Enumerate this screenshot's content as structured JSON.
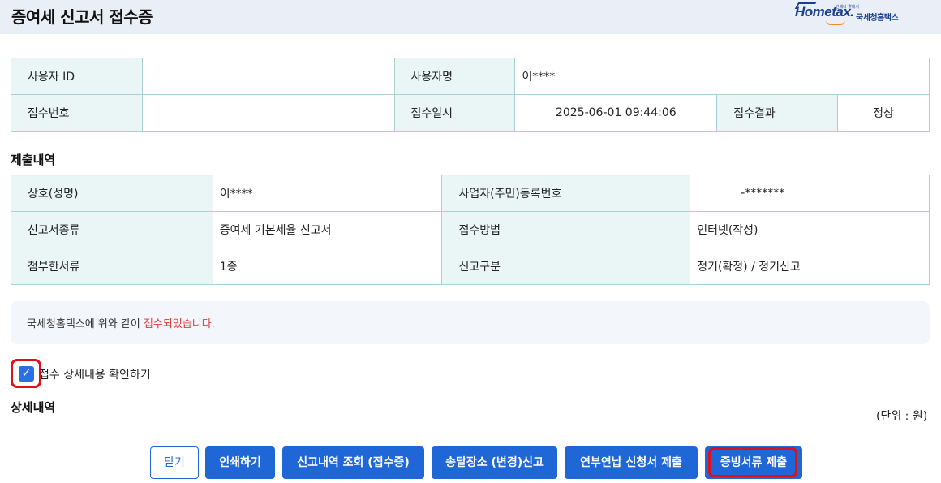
{
  "header": {
    "title": "증여세 신고서 접수증",
    "logo_text": "Hometax.",
    "logo_small": "언제나 곁에서",
    "logo_sub": "국세청홈택스"
  },
  "user_info": {
    "user_id_label": "사용자 ID",
    "user_id_value": "",
    "user_name_label": "사용자명",
    "user_name_value": "이****",
    "receipt_no_label": "접수번호",
    "receipt_no_value": "",
    "receipt_time_label": "접수일시",
    "receipt_time_value": "2025-06-01 09:44:06",
    "receipt_result_label": "접수결과",
    "receipt_result_value": "정상"
  },
  "submission": {
    "title": "제출내역",
    "rows": [
      {
        "label1": "상호(성명)",
        "value1": "이****",
        "label2": "사업자(주민)등록번호",
        "value2": "-*******"
      },
      {
        "label1": "신고서종류",
        "value1": "증여세 기본세율 신고서",
        "label2": "접수방법",
        "value2": "인터넷(작성)"
      },
      {
        "label1": "첨부한서류",
        "value1": "1종",
        "label2": "신고구분",
        "value2": "정기(확정) / 정기신고"
      }
    ]
  },
  "notice": {
    "text": "국세청홈택스에 위와 같이 ",
    "highlight": "접수되었습니다."
  },
  "detail_checkbox": {
    "label": "접수 상세내용 확인하기",
    "checked": true
  },
  "detail": {
    "title": "상세내역",
    "unit": "(단위 : 원)"
  },
  "buttons": {
    "close": "닫기",
    "print": "인쇄하기",
    "inquiry": "신고내역 조회 (접수증)",
    "delivery": "송달장소 (변경)신고",
    "installment": "연부연납 신청서 제출",
    "evidence": "증빙서류 제출"
  },
  "colors": {
    "primary": "#1f66d6",
    "highlight_text": "#e53935",
    "annotation_box": "#e0101a",
    "label_bg": "#eaf5f5",
    "header_bg": "#e9eef7"
  }
}
